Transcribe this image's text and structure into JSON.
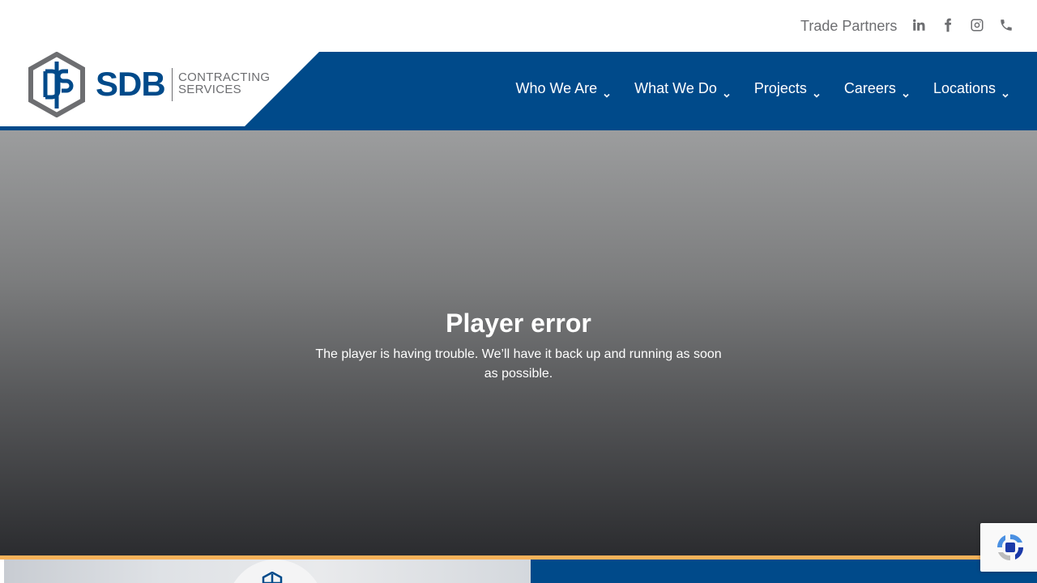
{
  "utility": {
    "trade_partners": "Trade Partners",
    "icons": [
      "linkedin-icon",
      "facebook-icon",
      "instagram-icon",
      "phone-icon"
    ]
  },
  "logo": {
    "word": "SDB",
    "line1": "CONTRACTING",
    "line2": "SERVICES"
  },
  "nav": {
    "items": [
      {
        "label": "Who We Are"
      },
      {
        "label": "What We Do"
      },
      {
        "label": "Projects"
      },
      {
        "label": "Careers"
      },
      {
        "label": "Locations"
      }
    ]
  },
  "player": {
    "title": "Player error",
    "message": "The player is having trouble. We’ll have it back up and running as soon as possible."
  },
  "colors": {
    "brand_blue": "#004a8a",
    "accent_orange": "#f6b25a",
    "grey_text": "#6d6e71"
  }
}
